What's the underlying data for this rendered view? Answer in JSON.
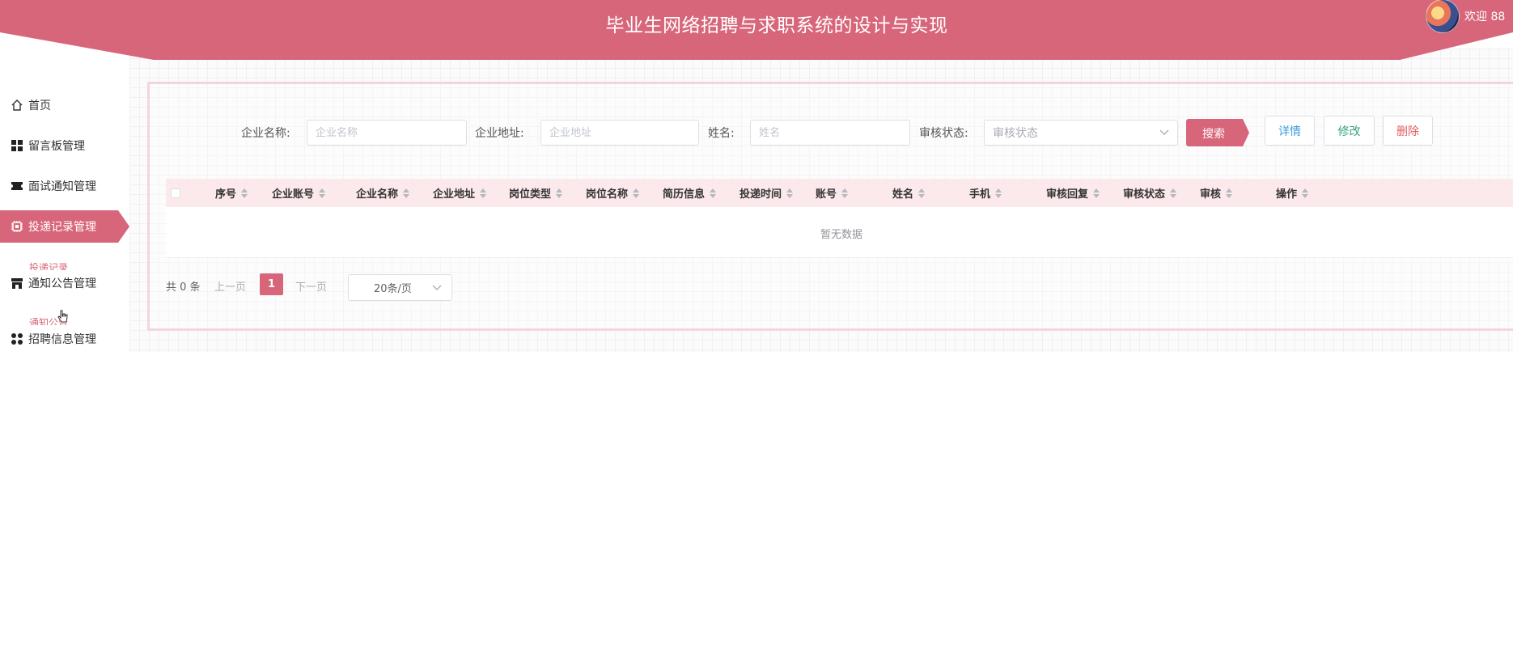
{
  "header": {
    "title": "毕业生网络招聘与求职系统的设计与实现",
    "welcome": "欢迎 88",
    "colors": {
      "primary": "#d8667a",
      "tab_bg": "#fbe9ec"
    }
  },
  "sidebar": {
    "items": [
      {
        "label": "首页",
        "icon": "home-icon"
      },
      {
        "label": "留言板管理",
        "icon": "grid-icon"
      },
      {
        "label": "面试通知管理",
        "icon": "ticket-icon"
      },
      {
        "label": "投递记录管理",
        "icon": "chip-icon",
        "active": true
      },
      {
        "label": "通知公告管理",
        "icon": "store-icon"
      },
      {
        "label": "招聘信息管理",
        "icon": "apps-icon"
      }
    ],
    "sub_items": [
      "投递记录",
      "通知公告"
    ]
  },
  "search": {
    "company_name_label": "企业名称:",
    "company_name_placeholder": "企业名称",
    "company_address_label": "企业地址:",
    "company_address_placeholder": "企业地址",
    "name_label": "姓名:",
    "name_placeholder": "姓名",
    "status_label": "审核状态:",
    "status_placeholder": "审核状态",
    "search_button": "搜索"
  },
  "actions": {
    "detail": "详情",
    "edit": "修改",
    "delete": "删除"
  },
  "table": {
    "columns": [
      "序号",
      "企业账号",
      "企业名称",
      "企业地址",
      "岗位类型",
      "岗位名称",
      "简历信息",
      "投递时间",
      "账号",
      "姓名",
      "手机",
      "审核回复",
      "审核状态",
      "审核",
      "操作"
    ],
    "empty_text": "暂无数据"
  },
  "pagination": {
    "total": "共 0 条",
    "prev": "上一页",
    "current": "1",
    "next": "下一页",
    "page_size": "20条/页"
  }
}
